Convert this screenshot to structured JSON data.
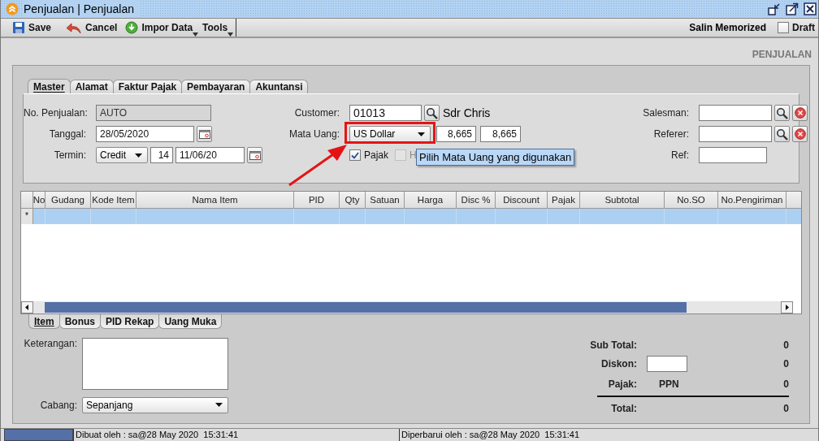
{
  "window": {
    "title": "Penjualan | Penjualan"
  },
  "toolbar": {
    "buttons": [
      {
        "label": "Save",
        "kind": "save"
      },
      {
        "label": "Cancel",
        "kind": "cancel"
      },
      {
        "label": "Impor Data",
        "kind": "import"
      },
      {
        "label": "Tools",
        "kind": "tools"
      }
    ],
    "memorized": "Salin Memorized",
    "draft": {
      "label": "Draft",
      "checked": false
    }
  },
  "heading": "PENJUALAN",
  "tabs": [
    {
      "label": "Master",
      "selected": true
    },
    {
      "label": "Alamat",
      "selected": false
    },
    {
      "label": "Faktur Pajak",
      "selected": false
    },
    {
      "label": "Pembayaran",
      "selected": false
    },
    {
      "label": "Akuntansi",
      "selected": false
    }
  ],
  "master": {
    "left": [
      {
        "label": "No. Penjualan:",
        "kind": "readonly",
        "value": "AUTO"
      },
      {
        "label": "Tanggal:",
        "kind": "date",
        "value": "28/05/2020"
      },
      {
        "label": "Termin:",
        "kind": "termin",
        "select": "Credit",
        "days": "14",
        "due": "11/06/20"
      }
    ],
    "middle": [
      {
        "label": "Customer:",
        "kind": "lookup",
        "value": "01013",
        "name": "Sdr Chris"
      },
      {
        "label": "Mata Uang:",
        "kind": "currency",
        "select": "US Dollar",
        "rate": "8,665",
        "tax_rate": "8,665"
      },
      {
        "kind": "checks",
        "checks": [
          {
            "label": "Pajak",
            "checked": true,
            "disabled": false
          },
          {
            "label": "H",
            "checked": false,
            "disabled": true
          }
        ]
      }
    ],
    "right": [
      {
        "label": "Salesman:",
        "kind": "lookup_clear"
      },
      {
        "label": "Referer:",
        "kind": "lookup_clear"
      },
      {
        "label": "Ref:",
        "kind": "text"
      }
    ]
  },
  "tooltip": "Pilih Mata Uang yang digunakan",
  "grid": {
    "columns": [
      "No",
      "Gudang",
      "Kode Item",
      "Nama Item",
      "PID",
      "Qty",
      "Satuan",
      "Harga",
      "Disc %",
      "Discount",
      "Pajak",
      "Subtotal",
      "No.SO",
      "No.Pengiriman"
    ],
    "new_row_marker": "*"
  },
  "bottom_tabs": [
    {
      "label": "Item",
      "selected": true
    },
    {
      "label": "Bonus",
      "selected": false
    },
    {
      "label": "PID Rekap",
      "selected": false
    },
    {
      "label": "Uang Muka",
      "selected": false
    }
  ],
  "notes": {
    "label": "Keterangan:"
  },
  "branch": {
    "label": "Cabang:",
    "value": "Sepanjang"
  },
  "totals": {
    "sub_total": {
      "label": "Sub Total:",
      "value": "0"
    },
    "discount": {
      "label": "Diskon:",
      "value": "0"
    },
    "tax": {
      "label": "Pajak:",
      "name": "PPN",
      "value": "0"
    },
    "total": {
      "label": "Total:",
      "value": "0"
    }
  },
  "status_bar": {
    "created": "Dibuat oleh : sa@28 May 2020  15:31:41",
    "updated": "Diperbarui oleh : sa@28 May 2020  15:31:41"
  }
}
